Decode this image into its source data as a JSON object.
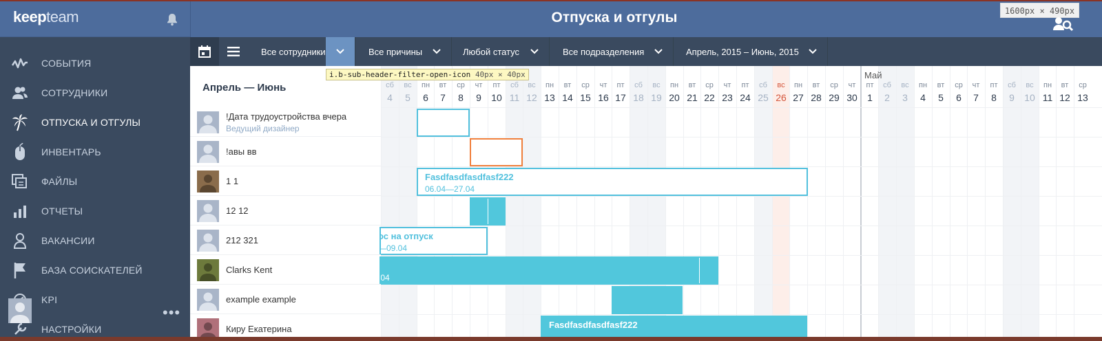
{
  "app": {
    "logo_part1": "keep",
    "logo_part2": "team",
    "page_title": "Отпуска и отгулы",
    "dim_badge": "1600px × 490px"
  },
  "sidebar": {
    "items": [
      {
        "label": "СОБЫТИЯ",
        "icon": "pulse-icon",
        "active": false
      },
      {
        "label": "СОТРУДНИКИ",
        "icon": "users-icon",
        "active": false
      },
      {
        "label": "ОТПУСКА И ОТГУЛЫ",
        "icon": "palm-tree-icon",
        "active": true
      },
      {
        "label": "ИНВЕНТАРЬ",
        "icon": "mouse-icon",
        "active": false
      },
      {
        "label": "ФАЙЛЫ",
        "icon": "files-icon",
        "active": false
      },
      {
        "label": "ОТЧЕТЫ",
        "icon": "bar-chart-icon",
        "active": false
      },
      {
        "label": "ВАКАНСИИ",
        "icon": "person-icon",
        "active": false
      },
      {
        "label": "БАЗА СОИСКАТЕЛЕЙ",
        "icon": "flag-icon",
        "active": false
      },
      {
        "label": "KPI",
        "icon": "kpi-icon",
        "active": false
      },
      {
        "label": "НАСТРОЙКИ",
        "icon": "wrench-icon",
        "active": false
      }
    ],
    "more_label": "•••"
  },
  "filters": {
    "employees": "Все сотрудники",
    "reasons": "Все причины",
    "status": "Любой статус",
    "departments": "Все подразделения",
    "period": "Апрель, 2015 – Июнь, 2015"
  },
  "tooltip": {
    "selector": "i.b-sub-header-filter-open-icon",
    "size": "40px × 40px"
  },
  "calendar": {
    "range_title": "Апрель — Июнь",
    "month_label_may": "Май",
    "days": [
      {
        "dow": "сб",
        "num": "4",
        "kind": "wk"
      },
      {
        "dow": "вс",
        "num": "5",
        "kind": "wk"
      },
      {
        "dow": "пн",
        "num": "6",
        "kind": ""
      },
      {
        "dow": "вт",
        "num": "7",
        "kind": ""
      },
      {
        "dow": "ср",
        "num": "8",
        "kind": ""
      },
      {
        "dow": "чт",
        "num": "9",
        "kind": ""
      },
      {
        "dow": "пт",
        "num": "10",
        "kind": ""
      },
      {
        "dow": "сб",
        "num": "11",
        "kind": "wk"
      },
      {
        "dow": "вс",
        "num": "12",
        "kind": "wk"
      },
      {
        "dow": "пн",
        "num": "13",
        "kind": ""
      },
      {
        "dow": "вт",
        "num": "14",
        "kind": ""
      },
      {
        "dow": "ср",
        "num": "15",
        "kind": ""
      },
      {
        "dow": "чт",
        "num": "16",
        "kind": ""
      },
      {
        "dow": "пт",
        "num": "17",
        "kind": ""
      },
      {
        "dow": "сб",
        "num": "18",
        "kind": "wk"
      },
      {
        "dow": "вс",
        "num": "19",
        "kind": "wk"
      },
      {
        "dow": "пн",
        "num": "20",
        "kind": ""
      },
      {
        "dow": "вт",
        "num": "21",
        "kind": ""
      },
      {
        "dow": "ср",
        "num": "22",
        "kind": ""
      },
      {
        "dow": "чт",
        "num": "23",
        "kind": ""
      },
      {
        "dow": "пт",
        "num": "24",
        "kind": ""
      },
      {
        "dow": "сб",
        "num": "25",
        "kind": "wk"
      },
      {
        "dow": "вс",
        "num": "26",
        "kind": "hol"
      },
      {
        "dow": "пн",
        "num": "27",
        "kind": ""
      },
      {
        "dow": "вт",
        "num": "28",
        "kind": ""
      },
      {
        "dow": "ср",
        "num": "29",
        "kind": ""
      },
      {
        "dow": "чт",
        "num": "30",
        "kind": ""
      },
      {
        "dow": "пт",
        "num": "1",
        "kind": ""
      },
      {
        "dow": "сб",
        "num": "2",
        "kind": "wk"
      },
      {
        "dow": "вс",
        "num": "3",
        "kind": "wk"
      },
      {
        "dow": "пн",
        "num": "4",
        "kind": ""
      },
      {
        "dow": "вт",
        "num": "5",
        "kind": ""
      },
      {
        "dow": "ср",
        "num": "6",
        "kind": ""
      },
      {
        "dow": "чт",
        "num": "7",
        "kind": ""
      },
      {
        "dow": "пт",
        "num": "8",
        "kind": ""
      },
      {
        "dow": "сб",
        "num": "9",
        "kind": "wk"
      },
      {
        "dow": "вс",
        "num": "10",
        "kind": "wk"
      },
      {
        "dow": "пн",
        "num": "11",
        "kind": ""
      },
      {
        "dow": "вт",
        "num": "12",
        "kind": ""
      },
      {
        "dow": "ср",
        "num": "13",
        "kind": ""
      }
    ],
    "employees": [
      {
        "name": "!Дата трудоустройства вчера",
        "position": "Ведущий дизайнер",
        "avatar": "placeholder"
      },
      {
        "name": "!авы вв",
        "position": "",
        "avatar": "placeholder"
      },
      {
        "name": "1 1",
        "position": "",
        "avatar": "photo"
      },
      {
        "name": "12 12",
        "position": "",
        "avatar": "placeholder"
      },
      {
        "name": "212 321",
        "position": "",
        "avatar": "placeholder"
      },
      {
        "name": "Clarks Kent",
        "position": "",
        "avatar": "photo"
      },
      {
        "name": "example example",
        "position": "",
        "avatar": "placeholder"
      },
      {
        "name": "Киру Екатерина",
        "position": "",
        "avatar": "photo"
      }
    ],
    "bars": [
      {
        "row": 0,
        "start": 2,
        "span": 3,
        "style": "outline",
        "title": "",
        "dates": ""
      },
      {
        "row": 1,
        "start": 5,
        "span": 3,
        "style": "orange",
        "title": "",
        "dates": ""
      },
      {
        "row": 2,
        "start": 2,
        "span": 22,
        "style": "outline",
        "title": "Fasdfasdfasdfasf222",
        "dates": "06.04—27.04"
      },
      {
        "row": 3,
        "start": 5,
        "span": 2,
        "style": "fill",
        "title": "",
        "dates": ""
      },
      {
        "row": 4,
        "start": 0,
        "span": 6,
        "style": "outline",
        "title": "ос на отпуск",
        "dates": "—09.04"
      },
      {
        "row": 5,
        "start": 0,
        "span": 19,
        "style": "fill",
        "title": "",
        "dates": ".04"
      },
      {
        "row": 6,
        "start": 13,
        "span": 4,
        "style": "fill",
        "title": "",
        "dates": ""
      },
      {
        "row": 7,
        "start": 9,
        "span": 15,
        "style": "fill",
        "title": "Fasdfasdfasdfasf222",
        "dates": ""
      }
    ]
  }
}
